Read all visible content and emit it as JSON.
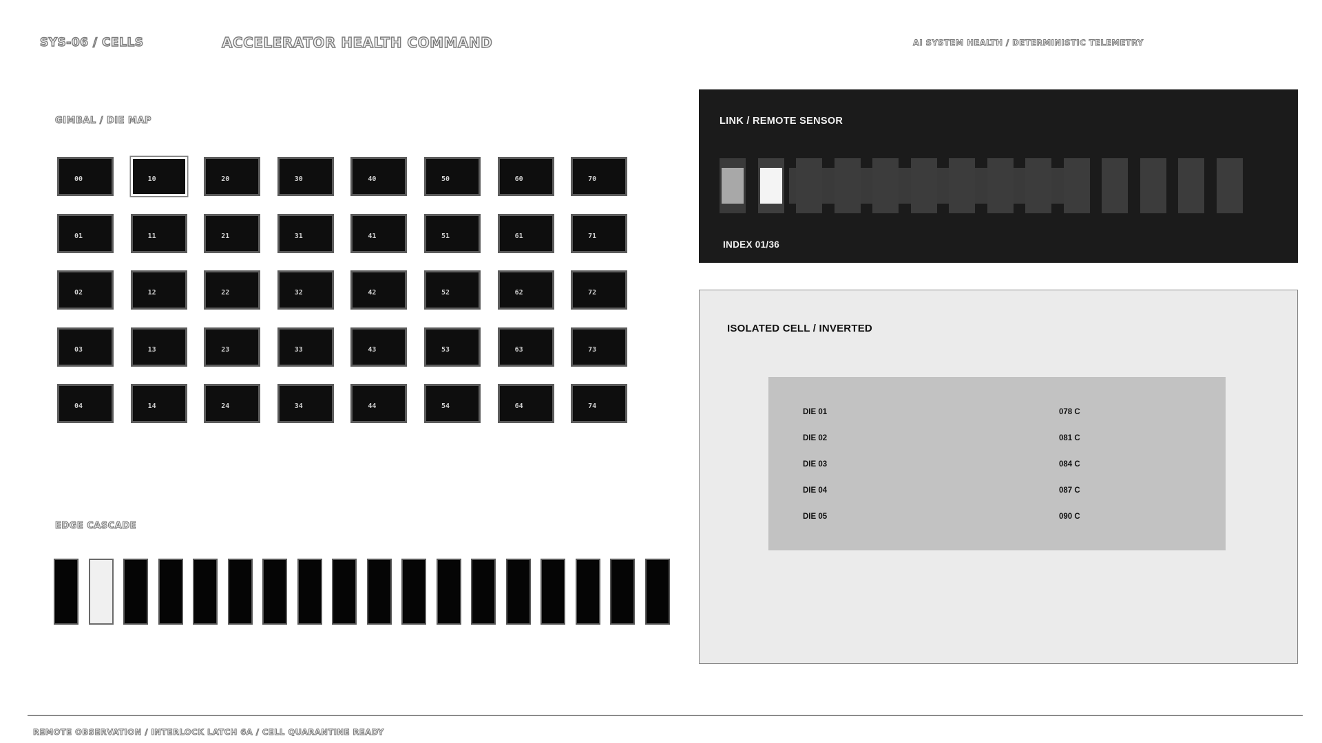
{
  "header": {
    "system": "SYS-06 / CELLS",
    "title": "ACCELERATOR HEALTH COMMAND",
    "subtitle": "AI SYSTEM HEALTH / DETERMINISTIC TELEMETRY"
  },
  "gimbal": {
    "label": "GIMBAL / DIE MAP",
    "active_cell": "10",
    "rows": [
      [
        "00",
        "10",
        "20",
        "30",
        "40",
        "50",
        "60",
        "70"
      ],
      [
        "01",
        "11",
        "21",
        "31",
        "41",
        "51",
        "61",
        "71"
      ],
      [
        "02",
        "12",
        "22",
        "32",
        "42",
        "52",
        "62",
        "72"
      ],
      [
        "03",
        "13",
        "23",
        "33",
        "43",
        "53",
        "63",
        "73"
      ],
      [
        "04",
        "14",
        "24",
        "34",
        "44",
        "54",
        "64",
        "74"
      ]
    ]
  },
  "cascade": {
    "label": "EDGE CASCADE",
    "bar_count": 18,
    "active_index": 1
  },
  "link": {
    "title": "LINK / REMOTE SENSOR",
    "index": "INDEX 01/36",
    "segment_count": 14,
    "active_segment": 1
  },
  "isolated": {
    "title": "ISOLATED CELL / INVERTED",
    "dies": [
      {
        "name": "DIE 01",
        "temp": "078 C"
      },
      {
        "name": "DIE 02",
        "temp": "081 C"
      },
      {
        "name": "DIE 03",
        "temp": "084 C"
      },
      {
        "name": "DIE 04",
        "temp": "087 C"
      },
      {
        "name": "DIE 05",
        "temp": "090 C"
      }
    ]
  },
  "footer": {
    "status": "REMOTE OBSERVATION / INTERLOCK LATCH 6A / CELL QUARANTINE READY"
  },
  "colors": {
    "background": "#ffffff",
    "cell_fill": "#0e0e0e",
    "panel_dark": "#1b1b1b",
    "panel_light": "#ebebeb",
    "inner_gray": "#c2c2c2"
  }
}
